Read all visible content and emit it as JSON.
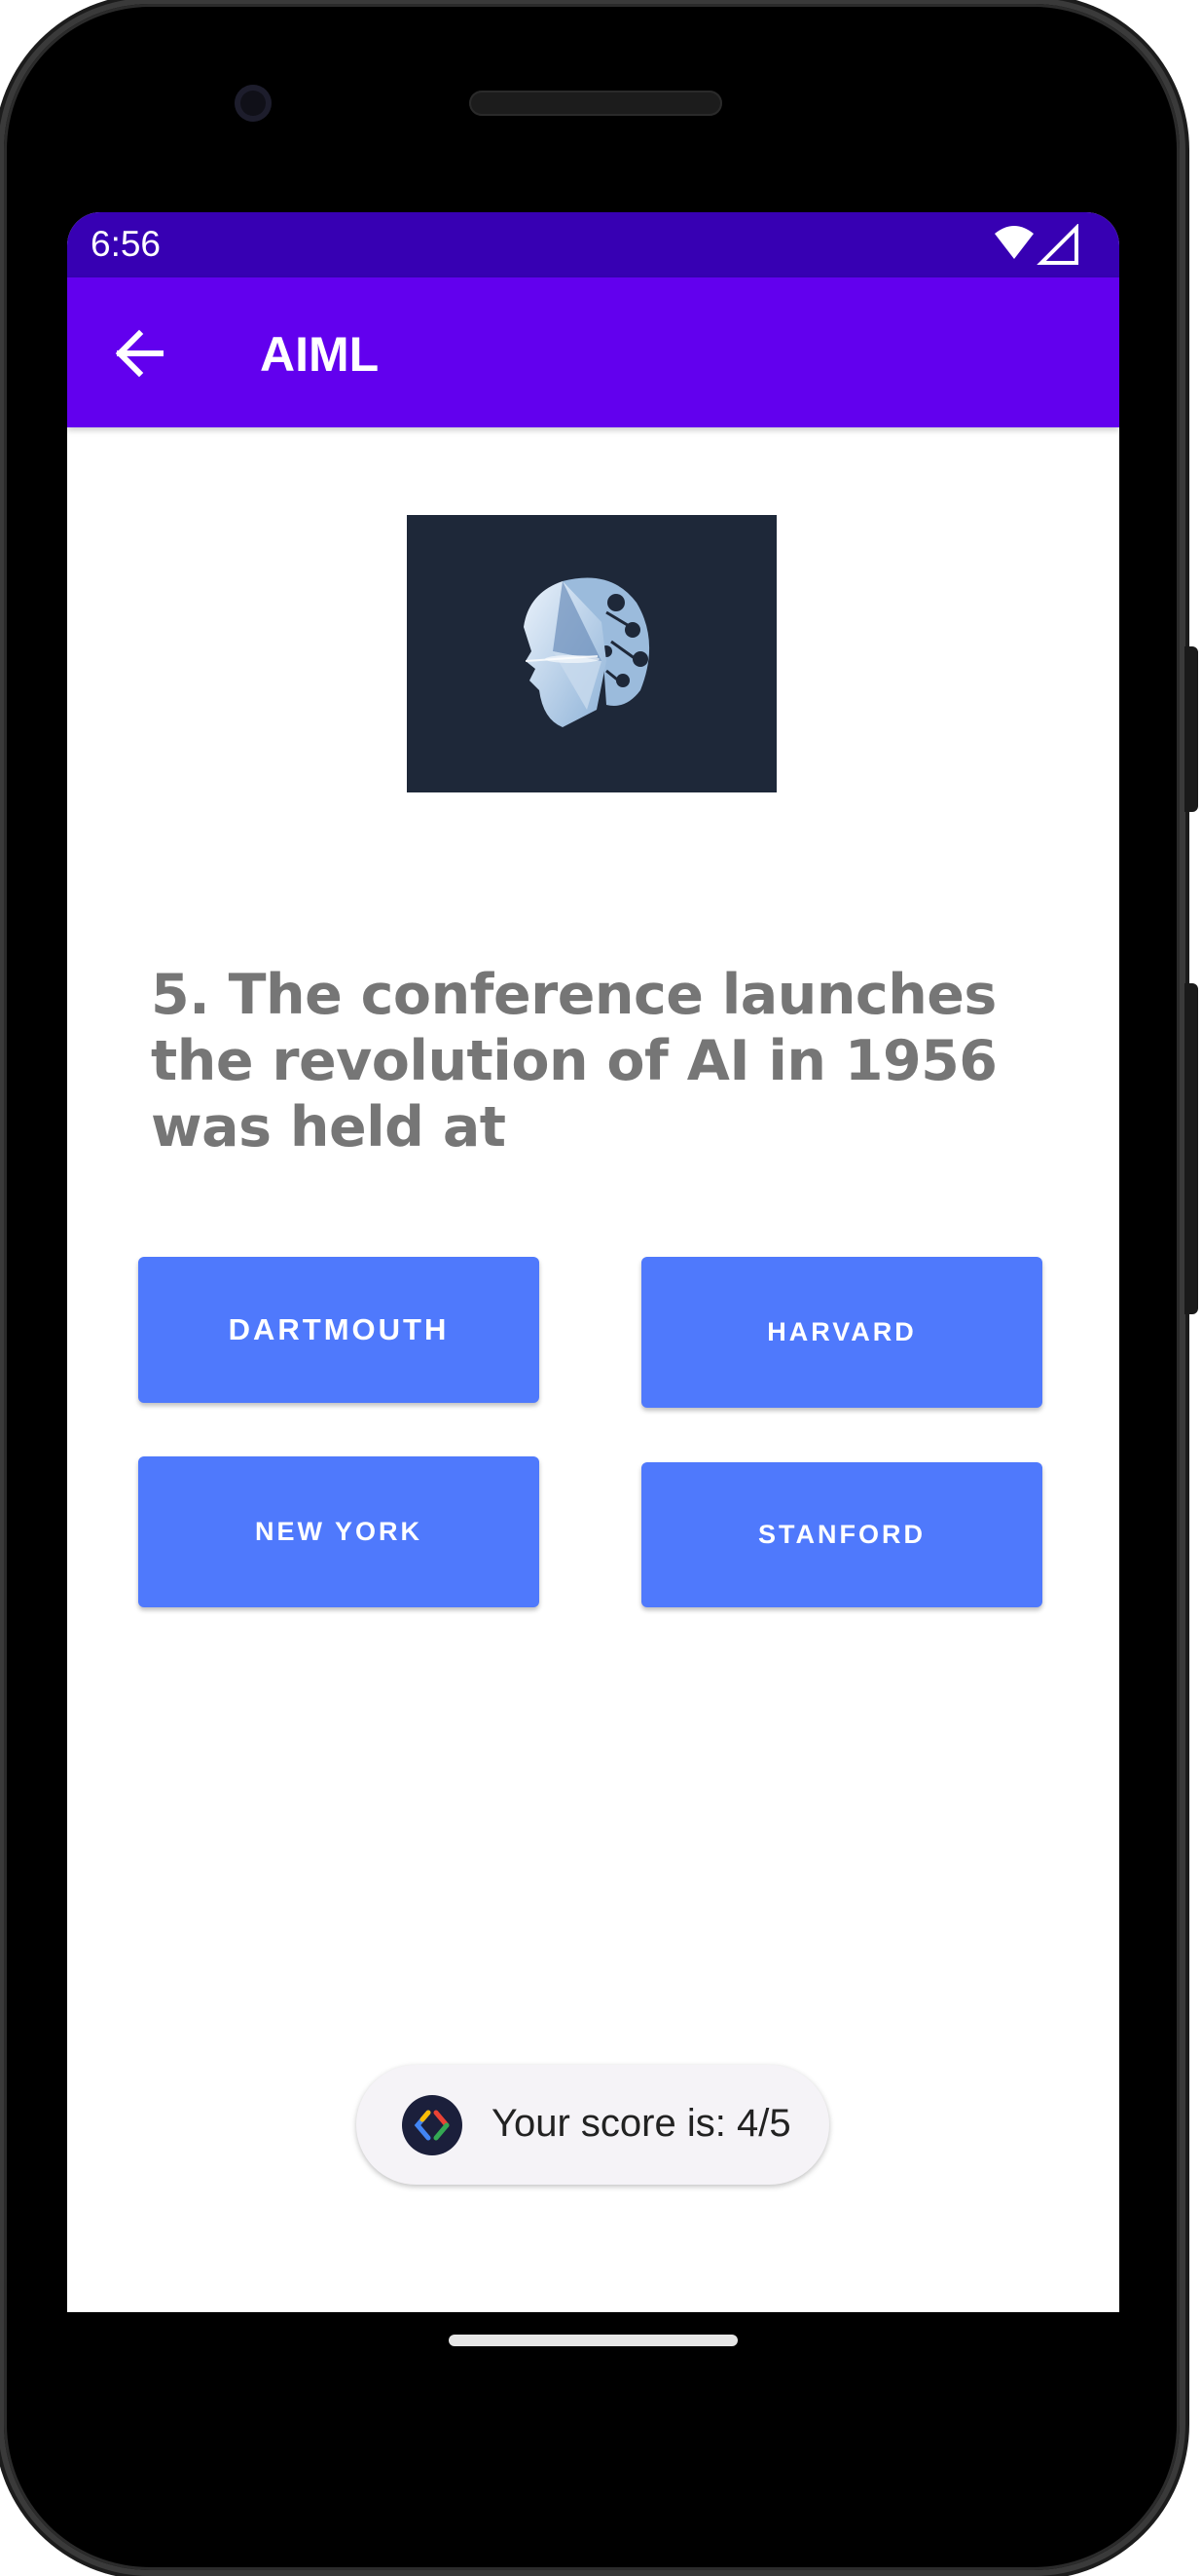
{
  "status_bar": {
    "time": "6:56",
    "icons": [
      "wifi-icon",
      "cell-signal-icon"
    ]
  },
  "app_bar": {
    "title": "AIML",
    "back_icon": "arrow-left-icon"
  },
  "hero": {
    "description_icon": "ai-head-icon"
  },
  "question": {
    "text": "5. The conference launches the revolution of AI in 1956 was held at"
  },
  "answers": [
    {
      "label": "DARTMOUTH"
    },
    {
      "label": "HARVARD"
    },
    {
      "label": "NEW YORK"
    },
    {
      "label": "STANFORD"
    }
  ],
  "toast": {
    "text": "Your score is: 4/5",
    "icon": "app-logo-icon"
  },
  "colors": {
    "status_bar": "#3700B3",
    "app_bar": "#6200EE",
    "button": "#4F79FC",
    "question_text": "#767676"
  }
}
